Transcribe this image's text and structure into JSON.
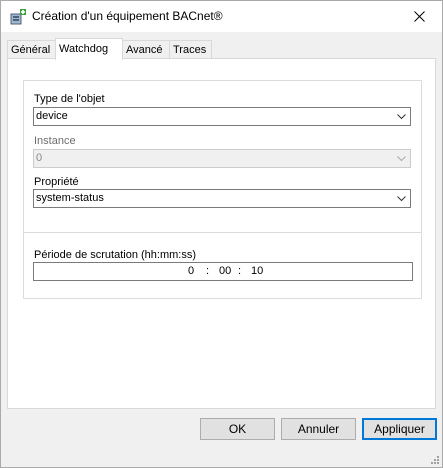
{
  "window": {
    "title": "Création d'un équipement BACnet®",
    "icon": "bacnet-device-add-icon"
  },
  "tabs": [
    {
      "label": "Général",
      "active": false
    },
    {
      "label": "Watchdog",
      "active": true
    },
    {
      "label": "Avancé",
      "active": false
    },
    {
      "label": "Traces",
      "active": false
    }
  ],
  "object_group": {
    "type_label": "Type de l'objet",
    "type_value": "device",
    "instance_label": "Instance",
    "instance_value": "0",
    "property_label": "Propriété",
    "property_value": "system-status"
  },
  "polling_group": {
    "label": "Période de scrutation (hh:mm:ss)",
    "hours": "0",
    "minutes": "00",
    "seconds": "10",
    "separator": ":"
  },
  "buttons": {
    "ok": "OK",
    "cancel": "Annuler",
    "apply": "Appliquer"
  },
  "colors": {
    "focus_border": "#0078d7",
    "button_face": "#e1e1e1",
    "dialog_bg": "#f0f0f0"
  }
}
